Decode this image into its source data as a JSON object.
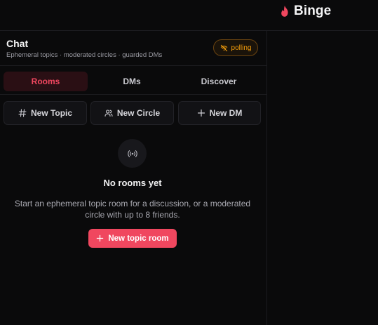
{
  "brand": {
    "name": "Binge",
    "icon": "flame-icon",
    "color": "#f0475f"
  },
  "chat": {
    "title": "Chat",
    "subtitle": "Ephemeral topics · moderated circles · guarded DMs",
    "status": {
      "label": "polling",
      "icon": "no-signal-icon",
      "color": "#f59e0b"
    }
  },
  "tabs": [
    {
      "label": "Rooms",
      "active": true
    },
    {
      "label": "DMs",
      "active": false
    },
    {
      "label": "Discover",
      "active": false
    }
  ],
  "actions": [
    {
      "label": "New Topic",
      "icon": "hash-icon"
    },
    {
      "label": "New Circle",
      "icon": "users-icon"
    },
    {
      "label": "New DM",
      "icon": "plus-icon"
    }
  ],
  "empty_state": {
    "icon": "broadcast-icon",
    "title": "No rooms yet",
    "description": "Start an ephemeral topic room for a discussion, or a moderated circle with up to 8 friends.",
    "cta_label": "New topic room",
    "cta_icon": "plus-icon"
  },
  "colors": {
    "accent": "#f0475f",
    "background": "#0a0a0b",
    "warning": "#f59e0b"
  }
}
